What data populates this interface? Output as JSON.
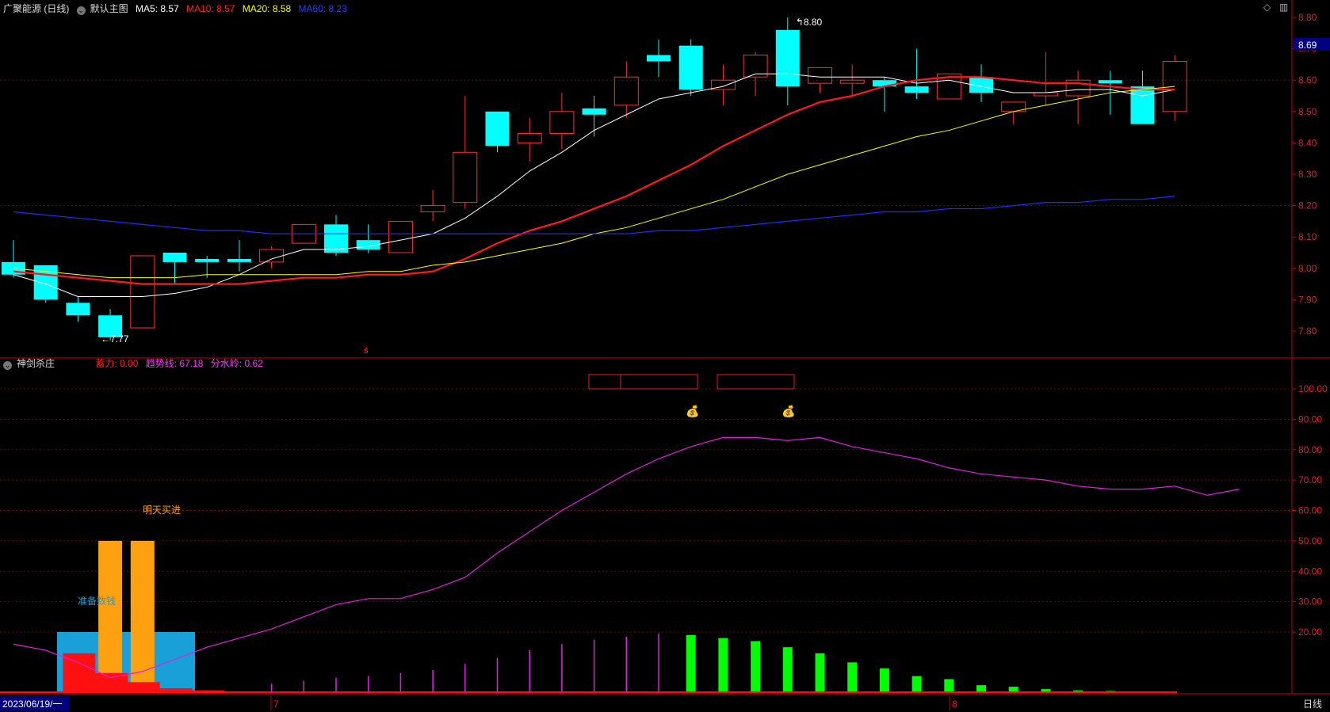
{
  "header": {
    "stock": "广聚能源 (日线)",
    "main_name": "默认主图",
    "ma5": "MA5: 8.57",
    "ma10": "MA10: 8.57",
    "ma20": "MA20: 8.58",
    "ma60": "MA60: 8.23",
    "ma5_color": "#ffffff",
    "ma10_color": "#ff2020",
    "ma20_color": "#ffff00",
    "ma60_color": "#2040ff"
  },
  "sub_header": {
    "name": "神剑杀庄",
    "xuli": "蓄力: 0.00",
    "qushi": "趋势线: 67.18",
    "fenshui": "分水岭: 0.62"
  },
  "icons": {
    "expand": "diamond-icon",
    "menu": "grid-icon",
    "collapse": "chevron-down-icon"
  },
  "bottom": {
    "date": "2023/06/19/一",
    "month7": "7",
    "month8": "8",
    "period": "日线"
  },
  "price_badge": "8.69",
  "annotations": {
    "high": "8.80",
    "low": "7.77",
    "buy": "明天买进",
    "prepare": "准备数钱"
  },
  "chart_data": [
    {
      "type": "candlestick",
      "ylim": [
        7.7,
        8.82
      ],
      "yticks": [
        "8.80",
        "8.70",
        "8.60",
        "8.50",
        "8.40",
        "8.30",
        "8.20",
        "8.10",
        "8.00",
        "7.90",
        "7.80"
      ],
      "candles": [
        [
          8.02,
          8.09,
          7.97,
          7.98
        ],
        [
          8.01,
          8.01,
          7.89,
          7.9
        ],
        [
          7.89,
          7.91,
          7.83,
          7.85
        ],
        [
          7.85,
          7.87,
          7.77,
          7.78
        ],
        [
          7.81,
          8.04,
          7.81,
          8.04
        ],
        [
          8.05,
          8.05,
          7.95,
          8.02
        ],
        [
          8.03,
          8.04,
          7.97,
          8.02
        ],
        [
          8.03,
          8.09,
          7.99,
          8.02
        ],
        [
          8.02,
          8.07,
          8.0,
          8.06
        ],
        [
          8.08,
          8.14,
          8.08,
          8.14
        ],
        [
          8.14,
          8.17,
          8.04,
          8.05
        ],
        [
          8.09,
          8.14,
          8.05,
          8.06
        ],
        [
          8.05,
          8.15,
          8.05,
          8.15
        ],
        [
          8.18,
          8.25,
          8.15,
          8.2
        ],
        [
          8.21,
          8.55,
          8.19,
          8.37
        ],
        [
          8.5,
          8.5,
          8.37,
          8.39
        ],
        [
          8.4,
          8.48,
          8.34,
          8.43
        ],
        [
          8.43,
          8.56,
          8.38,
          8.5
        ],
        [
          8.51,
          8.55,
          8.42,
          8.49
        ],
        [
          8.52,
          8.66,
          8.48,
          8.61
        ],
        [
          8.68,
          8.73,
          8.61,
          8.66
        ],
        [
          8.71,
          8.73,
          8.55,
          8.57
        ],
        [
          8.57,
          8.65,
          8.52,
          8.6
        ],
        [
          8.61,
          8.69,
          8.55,
          8.68
        ],
        [
          8.76,
          8.8,
          8.52,
          8.58
        ],
        [
          8.59,
          8.64,
          8.56,
          8.64
        ],
        [
          8.59,
          8.65,
          8.55,
          8.6
        ],
        [
          8.6,
          8.61,
          8.5,
          8.58
        ],
        [
          8.58,
          8.7,
          8.54,
          8.56
        ],
        [
          8.54,
          8.62,
          8.54,
          8.62
        ],
        [
          8.61,
          8.65,
          8.53,
          8.56
        ],
        [
          8.5,
          8.53,
          8.46,
          8.53
        ],
        [
          8.55,
          8.69,
          8.52,
          8.56
        ],
        [
          8.55,
          8.63,
          8.46,
          8.6
        ],
        [
          8.6,
          8.63,
          8.49,
          8.59
        ],
        [
          8.58,
          8.63,
          8.46,
          8.46
        ],
        [
          8.5,
          8.68,
          8.47,
          8.66
        ]
      ],
      "series": [
        {
          "name": "MA5",
          "values": [
            7.98,
            7.95,
            7.91,
            7.91,
            7.91,
            7.92,
            7.94,
            7.98,
            8.03,
            8.06,
            8.06,
            8.07,
            8.09,
            8.11,
            8.16,
            8.23,
            8.31,
            8.37,
            8.44,
            8.49,
            8.54,
            8.56,
            8.58,
            8.62,
            8.62,
            8.61,
            8.61,
            8.61,
            8.59,
            8.6,
            8.58,
            8.56,
            8.56,
            8.57,
            8.57,
            8.55,
            8.57
          ]
        },
        {
          "name": "MA10",
          "values": [
            7.99,
            7.98,
            7.97,
            7.96,
            7.95,
            7.95,
            7.95,
            7.95,
            7.96,
            7.97,
            7.97,
            7.98,
            7.98,
            7.99,
            8.03,
            8.08,
            8.12,
            8.15,
            8.19,
            8.23,
            8.28,
            8.33,
            8.39,
            8.44,
            8.49,
            8.53,
            8.55,
            8.58,
            8.6,
            8.61,
            8.61,
            8.6,
            8.59,
            8.59,
            8.58,
            8.57,
            8.57
          ]
        },
        {
          "name": "MA20",
          "values": [
            8.0,
            7.99,
            7.98,
            7.97,
            7.97,
            7.97,
            7.98,
            7.98,
            7.98,
            7.98,
            7.98,
            7.99,
            7.99,
            8.01,
            8.02,
            8.04,
            8.06,
            8.08,
            8.11,
            8.13,
            8.16,
            8.19,
            8.22,
            8.26,
            8.3,
            8.33,
            8.36,
            8.39,
            8.42,
            8.44,
            8.47,
            8.5,
            8.52,
            8.54,
            8.56,
            8.57,
            8.58
          ]
        },
        {
          "name": "MA60",
          "values": [
            8.18,
            8.17,
            8.16,
            8.15,
            8.14,
            8.13,
            8.12,
            8.12,
            8.11,
            8.11,
            8.11,
            8.11,
            8.11,
            8.11,
            8.11,
            8.11,
            8.11,
            8.11,
            8.11,
            8.11,
            8.12,
            8.12,
            8.13,
            8.14,
            8.15,
            8.16,
            8.17,
            8.18,
            8.18,
            8.19,
            8.19,
            8.2,
            8.21,
            8.21,
            8.22,
            8.22,
            8.23
          ]
        }
      ]
    },
    {
      "type": "indicator",
      "ylim": [
        0,
        105
      ],
      "yticks": [
        "100.00",
        "90.00",
        "80.00",
        "70.00",
        "60.00",
        "50.00",
        "40.00",
        "30.00",
        "20.00"
      ],
      "trend": [
        16,
        14,
        10,
        5,
        7,
        11,
        15,
        18,
        21,
        25,
        29,
        31,
        31,
        34,
        38,
        46,
        53,
        60,
        66,
        72,
        77,
        81,
        84,
        84,
        83,
        84,
        81,
        79,
        77,
        74,
        72,
        71,
        70,
        68,
        67,
        67,
        68,
        65,
        67
      ],
      "green_bars": [
        0,
        0,
        0,
        0,
        0,
        0,
        0,
        0,
        0,
        0,
        0,
        0,
        0,
        0,
        0,
        0,
        0,
        0,
        0,
        0,
        0,
        19,
        18,
        17,
        15,
        13,
        10,
        8,
        5.5,
        4.5,
        2.5,
        2,
        1.2,
        0.8,
        0.6,
        0.4
      ],
      "magenta_bars": [
        0,
        0,
        0,
        0,
        0,
        0,
        0,
        0,
        3,
        4,
        5,
        5.5,
        6.5,
        7.5,
        9.5,
        11.5,
        14,
        16,
        17.5,
        18.5,
        19.5,
        0,
        0,
        0,
        0,
        0,
        0,
        0,
        0,
        0,
        0,
        0,
        0,
        0,
        0,
        0
      ],
      "red_bars": [
        0,
        0,
        13,
        6.5,
        3.5,
        1.5,
        0.8,
        0.4,
        0,
        0,
        0,
        0,
        0,
        0,
        0,
        0,
        0,
        0,
        0,
        0,
        0,
        0,
        0,
        0,
        0,
        0,
        0,
        0,
        0,
        0,
        0,
        0,
        0,
        0,
        0,
        0
      ],
      "orange_bars": [
        0,
        0,
        0,
        50,
        50,
        0,
        0,
        0,
        0,
        0,
        0,
        0,
        0,
        0,
        0,
        0,
        0,
        0,
        0,
        0,
        0,
        0,
        0,
        0,
        0,
        0,
        0,
        0,
        0,
        0,
        0,
        0,
        0,
        0,
        0,
        0
      ],
      "blue_area": 20
    }
  ]
}
